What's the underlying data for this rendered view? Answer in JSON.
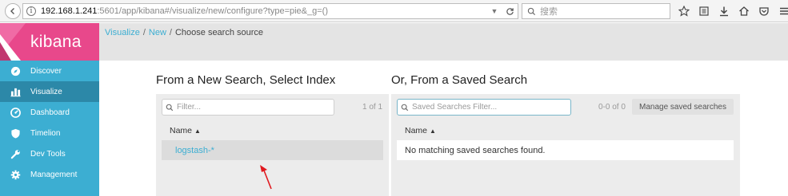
{
  "browser": {
    "url_host": "192.168.1.241",
    "url_rest": ":5601/app/kibana#/visualize/new/configure?type=pie&_g=()",
    "search_placeholder": "搜索"
  },
  "app": {
    "brand": "kibana"
  },
  "sidebar": {
    "items": [
      {
        "label": "Discover",
        "icon": "compass-icon",
        "active": false
      },
      {
        "label": "Visualize",
        "icon": "bar-chart-icon",
        "active": true
      },
      {
        "label": "Dashboard",
        "icon": "dashboard-gauge-icon",
        "active": false
      },
      {
        "label": "Timelion",
        "icon": "shield-icon",
        "active": false
      },
      {
        "label": "Dev Tools",
        "icon": "wrench-icon",
        "active": false
      },
      {
        "label": "Management",
        "icon": "gear-icon",
        "active": false
      }
    ]
  },
  "breadcrumb": {
    "link1": "Visualize",
    "link2": "New",
    "current": "Choose search source",
    "separator": "/"
  },
  "new_search": {
    "title": "From a New Search, Select Index",
    "filter_placeholder": "Filter...",
    "pager": "1 of 1",
    "column": "Name",
    "sort_indicator": "▲",
    "rows": [
      "logstash-*"
    ]
  },
  "saved_search": {
    "title": "Or, From a Saved Search",
    "filter_placeholder": "Saved Searches Filter...",
    "pager": "0-0 of 0",
    "manage_label": "Manage saved searches",
    "column": "Name",
    "sort_indicator": "▲",
    "empty_message": "No matching saved searches found."
  },
  "colors": {
    "brand_pink": "#e8488b",
    "sidebar_blue": "#3caed2",
    "sidebar_active": "#2c88a8",
    "annotation_red": "#e0191f"
  }
}
